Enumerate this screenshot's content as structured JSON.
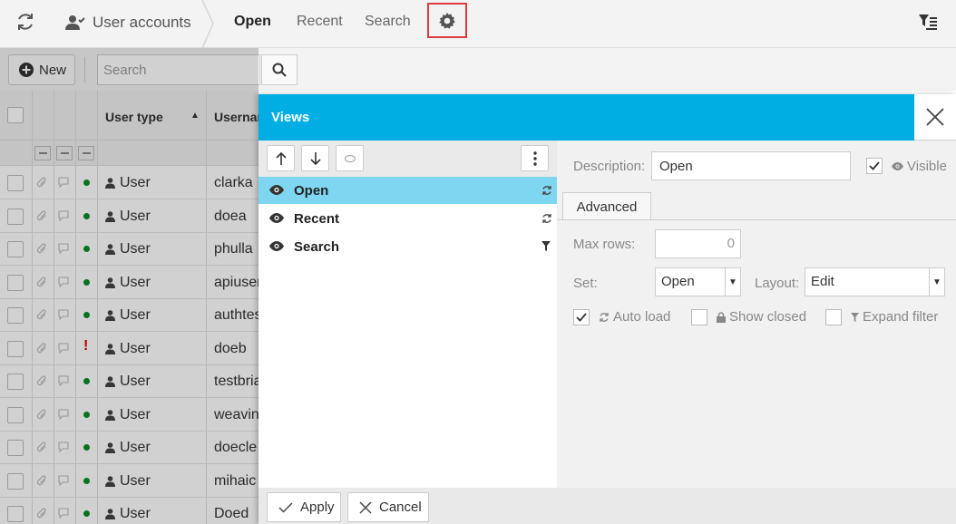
{
  "header": {
    "app_title": "User accounts",
    "tabs": [
      {
        "label": "Open",
        "active": true
      },
      {
        "label": "Recent",
        "active": false
      },
      {
        "label": "Search",
        "active": false
      }
    ]
  },
  "toolbar": {
    "new_label": "New",
    "search_placeholder": "Search"
  },
  "grid": {
    "columns": [
      "User type",
      "Username"
    ],
    "sort": "ascending",
    "rows": [
      {
        "user_type": "User",
        "username": "clarka",
        "status": "active"
      },
      {
        "user_type": "User",
        "username": "doea",
        "status": "active"
      },
      {
        "user_type": "User",
        "username": "phulla",
        "status": "active"
      },
      {
        "user_type": "User",
        "username": "apiuser",
        "status": "active"
      },
      {
        "user_type": "User",
        "username": "authtest",
        "status": "active"
      },
      {
        "user_type": "User",
        "username": "doeb",
        "status": "warning"
      },
      {
        "user_type": "User",
        "username": "testbria",
        "status": "active"
      },
      {
        "user_type": "User",
        "username": "weaving",
        "status": "active"
      },
      {
        "user_type": "User",
        "username": "doecle",
        "status": "active"
      },
      {
        "user_type": "User",
        "username": "mihaic",
        "status": "active"
      },
      {
        "user_type": "User",
        "username": "Doed",
        "status": "active"
      }
    ]
  },
  "dialog": {
    "title": "Views",
    "views": [
      {
        "label": "Open",
        "selected": true,
        "icon": "refresh-icon"
      },
      {
        "label": "Recent",
        "selected": false,
        "icon": "refresh-icon"
      },
      {
        "label": "Search",
        "selected": false,
        "icon": "filter-icon"
      }
    ],
    "description_label": "Description:",
    "description_value": "Open",
    "visible_label": "Visible",
    "visible_checked": true,
    "advanced_tab": "Advanced",
    "max_rows_label": "Max rows:",
    "max_rows_value": "0",
    "set_label": "Set:",
    "set_value": "Open",
    "layout_label": "Layout:",
    "layout_value": "Edit",
    "auto_load_label": "Auto load",
    "auto_load_checked": true,
    "show_closed_label": "Show closed",
    "show_closed_checked": false,
    "expand_filter_label": "Expand filter",
    "expand_filter_checked": false,
    "apply_label": "Apply",
    "cancel_label": "Cancel"
  },
  "colors": {
    "accent": "#00aee4",
    "selected_row": "#7fd6f0",
    "highlight_box": "#e03b3b",
    "status_active": "#0a8a2a",
    "status_warning": "#dd0000"
  }
}
